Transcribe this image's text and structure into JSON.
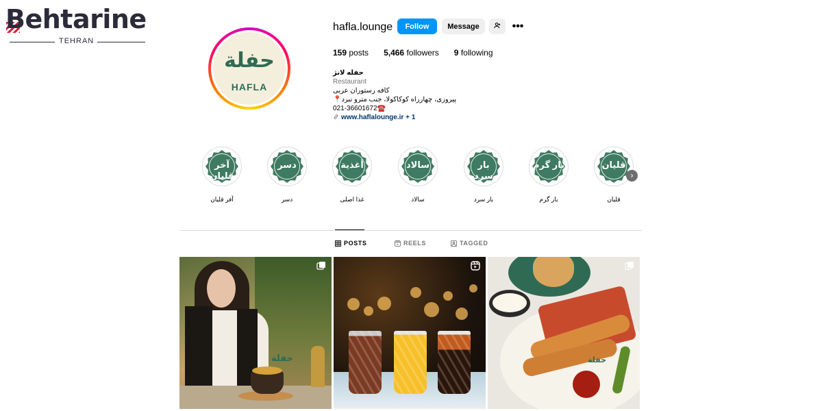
{
  "watermark": {
    "word": "Behtarine",
    "sub": "TEHRAN"
  },
  "profile": {
    "avatar_text_ar": "حفلة",
    "avatar_text_en": "HAFLA",
    "username": "hafla.lounge",
    "follow_label": "Follow",
    "message_label": "Message",
    "more_label": "•••",
    "stats": {
      "posts_count": "159",
      "posts_label": "posts",
      "followers_count": "5,466",
      "followers_label": "followers",
      "following_count": "9",
      "following_label": "following"
    },
    "bio": {
      "name": "حفله لانژ",
      "category": "Restaurant",
      "line1": "کافه رستوران عربی",
      "line2": "📍پیروزی، چهارراه کوکاکولا، جنب مترو نبرد",
      "line3": "021-36601672☎️",
      "link": "www.haflalounge.ir",
      "link_more": "+ 1"
    }
  },
  "highlights": [
    {
      "glyph": "آخر قلیان",
      "label": "آفر قلیان"
    },
    {
      "glyph": "دسر",
      "label": "دسر"
    },
    {
      "glyph": "أغذية",
      "label": "غذا اصلی"
    },
    {
      "glyph": "سالاد",
      "label": "سالاد"
    },
    {
      "glyph": "بار سرد",
      "label": "بار سرد"
    },
    {
      "glyph": "بار گرم",
      "label": "بار گرم"
    },
    {
      "glyph": "قلیان",
      "label": "قلیان"
    }
  ],
  "tabs": {
    "posts": "POSTS",
    "reels": "REELS",
    "tagged": "TAGGED"
  },
  "posts": {
    "post1_logo": "حفلة",
    "post3_logo": "حفلة"
  }
}
